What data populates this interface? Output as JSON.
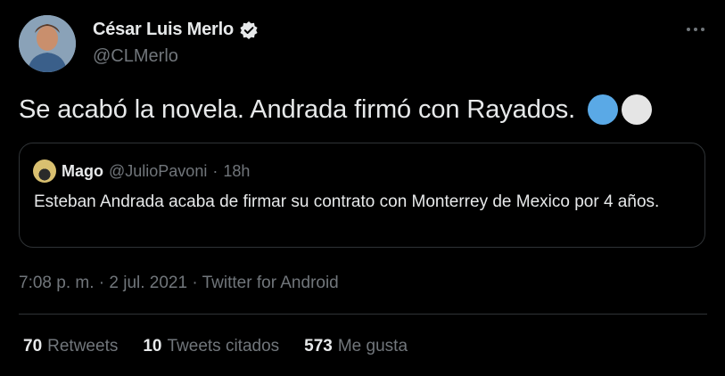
{
  "author": {
    "name": "César Luis Merlo",
    "handle": "@CLMerlo",
    "verified": true,
    "avatar_icon": "profile-photo"
  },
  "tweet": {
    "text": "Se acabó la novela. Andrada firmó con Rayados.",
    "emoji": [
      "blue-circle",
      "white-circle"
    ]
  },
  "quote": {
    "name": "Mago",
    "handle": "@JulioPavoni",
    "separator": "·",
    "time": "18h",
    "text": "Esteban Andrada acaba de firmar su contrato con Monterrey de Mexico por 4 años."
  },
  "meta": {
    "time": "7:08 p. m.",
    "sep1": "·",
    "date": "2 jul. 2021",
    "sep2": "·",
    "source": "Twitter for Android"
  },
  "stats": {
    "retweets_count": "70",
    "retweets_label": "Retweets",
    "quotes_count": "10",
    "quotes_label": "Tweets citados",
    "likes_count": "573",
    "likes_label": "Me gusta"
  },
  "colors": {
    "background": "#000000",
    "text_primary": "#e7e9ea",
    "text_secondary": "#71767b",
    "border": "#2f3336",
    "emoji_blue": "#5aa9e6",
    "emoji_white": "#e5e5e5"
  }
}
